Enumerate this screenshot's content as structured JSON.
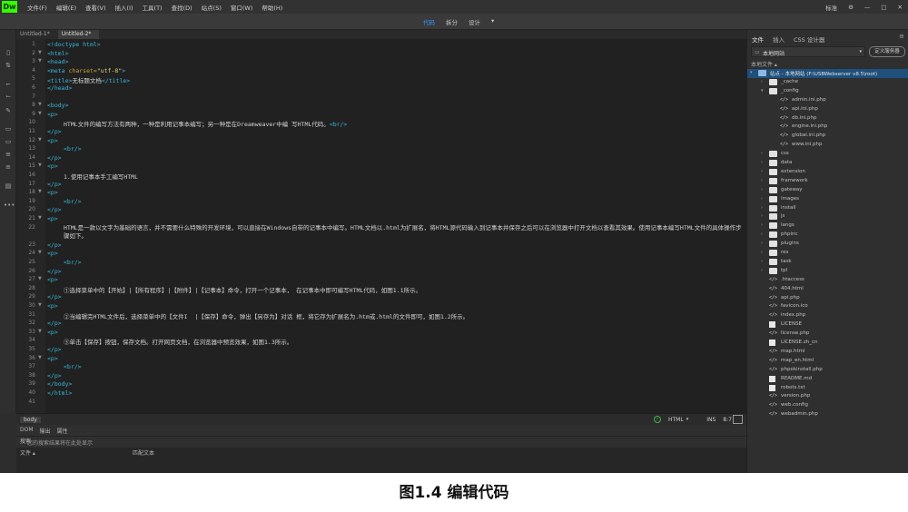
{
  "app": {
    "logo": "Dw",
    "menu": [
      "文件(F)",
      "编辑(E)",
      "查看(V)",
      "插入(I)",
      "工具(T)",
      "查找(D)",
      "站点(S)",
      "窗口(W)",
      "帮助(H)"
    ],
    "workspace": "标准",
    "window_controls": [
      "—",
      "□",
      "✕"
    ]
  },
  "view_bar": {
    "tabs": [
      "代码",
      "拆分",
      "设计"
    ],
    "active": "代码",
    "dropdown": "▾"
  },
  "doc_tabs": [
    "Untitled-1*",
    "Untitled-2*"
  ],
  "active_doc": "Untitled-2*",
  "code": [
    {
      "n": "1",
      "fold": "",
      "text": "<!doctype html>"
    },
    {
      "n": "2",
      "fold": "▼",
      "text": "<html>"
    },
    {
      "n": "3",
      "fold": "▼",
      "text": "<head>"
    },
    {
      "n": "4",
      "fold": "",
      "text": "<meta charset=\"utf-8\">"
    },
    {
      "n": "5",
      "fold": "",
      "text": "<title>无标题文档</title>"
    },
    {
      "n": "6",
      "fold": "",
      "text": "</head>"
    },
    {
      "n": "7",
      "fold": "",
      "text": ""
    },
    {
      "n": "8",
      "fold": "▼",
      "text": "<body>"
    },
    {
      "n": "9",
      "fold": "▼",
      "text": "<p>"
    },
    {
      "n": "10",
      "fold": "",
      "text": "HTML文件的编写方法有两种，一种是利用记事本编写；另一种是在Dreamweaver中编 写HTML代码。<br/>"
    },
    {
      "n": "11",
      "fold": "",
      "text": "</p>"
    },
    {
      "n": "12",
      "fold": "▼",
      "text": "<p>"
    },
    {
      "n": "13",
      "fold": "",
      "text": "<br/>"
    },
    {
      "n": "14",
      "fold": "",
      "text": "</p>"
    },
    {
      "n": "15",
      "fold": "▼",
      "text": "<p>"
    },
    {
      "n": "16",
      "fold": "",
      "text": "1.使用记事本手工编写HTML"
    },
    {
      "n": "17",
      "fold": "",
      "text": "</p>"
    },
    {
      "n": "18",
      "fold": "▼",
      "text": "<p>"
    },
    {
      "n": "19",
      "fold": "",
      "text": "<br/>"
    },
    {
      "n": "20",
      "fold": "",
      "text": "</p>"
    },
    {
      "n": "21",
      "fold": "▼",
      "text": "<p>"
    },
    {
      "n": "22",
      "fold": "",
      "text": "HTML是一款以文字为基础的语言，并不需要什么特殊的开发环境，可以直接在Windows自带的记事本中编写。HTML文档以.html为扩展名，将HTML源代码输入到记事本并保存之后可以在浏览器中打开文档以查看其效果。使用记事本编写HTML文件的具体操作步骤如下。"
    },
    {
      "n": "23",
      "fold": "",
      "text": "</p>"
    },
    {
      "n": "24",
      "fold": "▼",
      "text": "<p>"
    },
    {
      "n": "25",
      "fold": "",
      "text": "<br/>"
    },
    {
      "n": "26",
      "fold": "",
      "text": "</p>"
    },
    {
      "n": "27",
      "fold": "▼",
      "text": "<p>"
    },
    {
      "n": "28",
      "fold": "",
      "text": "①选择菜单中的【开始】|【所有程序】|【附件】|【记事本】命令，打开一个记事本， 在记事本中即可编写HTML代码，如图1.1所示。"
    },
    {
      "n": "29",
      "fold": "",
      "text": "</p>"
    },
    {
      "n": "30",
      "fold": "▼",
      "text": "<p>"
    },
    {
      "n": "31",
      "fold": "",
      "text": "②当编辑完HTML文件后，选择菜单中的【文件I  |【保存】命令，弹出【另存为】对话 框，将它存为扩展名为.htm或.html的文件即可，如图1.2所示。"
    },
    {
      "n": "32",
      "fold": "",
      "text": "</p>"
    },
    {
      "n": "33",
      "fold": "▼",
      "text": "<p>"
    },
    {
      "n": "34",
      "fold": "",
      "text": "③单击【保存】按钮，保存文档。打开网页文档，在浏览器中预览效果，如图1.3所示。"
    },
    {
      "n": "35",
      "fold": "",
      "text": "</p>"
    },
    {
      "n": "36",
      "fold": "▼",
      "text": "<p>"
    },
    {
      "n": "37",
      "fold": "",
      "text": "<br/>"
    },
    {
      "n": "38",
      "fold": "",
      "text": "</p>"
    },
    {
      "n": "39",
      "fold": "",
      "text": "</body>"
    },
    {
      "n": "40",
      "fold": "",
      "text": "</html>"
    },
    {
      "n": "41",
      "fold": "",
      "text": ""
    }
  ],
  "status_bar": {
    "tag": "body",
    "language": "HTML",
    "mode": "INS",
    "position": "8:7",
    "ok_icon": "✓"
  },
  "bottom_panel": {
    "tabs": [
      "DOM",
      "输出",
      "属性"
    ],
    "search_tab": "搜索",
    "search_placeholder": "您的搜索结果将在此处显示",
    "col_file": "文件 ▴",
    "col_match": "匹配文本"
  },
  "right_panel": {
    "tabs": [
      "文件",
      "插入",
      "CSS 设计器"
    ],
    "active_tab": "文件",
    "site_select": "本地网站",
    "define_button": "定义服务器",
    "local_label": "本地文件 ▴",
    "tree": [
      {
        "label": "站点 - 本地网站 (F:\\USBWebserver v8.5\\root)",
        "icon": "site",
        "depth": 0,
        "chev": "▾",
        "selected": true
      },
      {
        "label": "_cache",
        "icon": "folder",
        "depth": 1,
        "chev": "›"
      },
      {
        "label": "_config",
        "icon": "folder",
        "depth": 1,
        "chev": "▾"
      },
      {
        "label": "admin.ini.php",
        "icon": "code",
        "depth": 2,
        "chev": ""
      },
      {
        "label": "api.ini.php",
        "icon": "code",
        "depth": 2,
        "chev": ""
      },
      {
        "label": "db.ini.php",
        "icon": "code",
        "depth": 2,
        "chev": ""
      },
      {
        "label": "engine.ini.php",
        "icon": "code",
        "depth": 2,
        "chev": ""
      },
      {
        "label": "global.ini.php",
        "icon": "code",
        "depth": 2,
        "chev": ""
      },
      {
        "label": "www.ini.php",
        "icon": "code",
        "depth": 2,
        "chev": ""
      },
      {
        "label": "css",
        "icon": "folder",
        "depth": 1,
        "chev": "›"
      },
      {
        "label": "data",
        "icon": "folder",
        "depth": 1,
        "chev": "›"
      },
      {
        "label": "extension",
        "icon": "folder",
        "depth": 1,
        "chev": "›"
      },
      {
        "label": "framework",
        "icon": "folder",
        "depth": 1,
        "chev": "›"
      },
      {
        "label": "gateway",
        "icon": "folder",
        "depth": 1,
        "chev": "›"
      },
      {
        "label": "images",
        "icon": "folder",
        "depth": 1,
        "chev": "›"
      },
      {
        "label": "install",
        "icon": "folder",
        "depth": 1,
        "chev": "›"
      },
      {
        "label": "js",
        "icon": "folder",
        "depth": 1,
        "chev": "›"
      },
      {
        "label": "langs",
        "icon": "folder",
        "depth": 1,
        "chev": "›"
      },
      {
        "label": "phpinc",
        "icon": "folder",
        "depth": 1,
        "chev": "›"
      },
      {
        "label": "plugins",
        "icon": "folder",
        "depth": 1,
        "chev": "›"
      },
      {
        "label": "res",
        "icon": "folder",
        "depth": 1,
        "chev": "›"
      },
      {
        "label": "task",
        "icon": "folder",
        "depth": 1,
        "chev": "›"
      },
      {
        "label": "tpl",
        "icon": "folder",
        "depth": 1,
        "chev": "›"
      },
      {
        "label": ".htaccess",
        "icon": "code",
        "depth": 1,
        "chev": ""
      },
      {
        "label": "404.html",
        "icon": "code",
        "depth": 1,
        "chev": ""
      },
      {
        "label": "api.php",
        "icon": "code",
        "depth": 1,
        "chev": ""
      },
      {
        "label": "favicon.ico",
        "icon": "code",
        "depth": 1,
        "chev": ""
      },
      {
        "label": "index.php",
        "icon": "code",
        "depth": 1,
        "chev": ""
      },
      {
        "label": "LICENSE",
        "icon": "doc",
        "depth": 1,
        "chev": ""
      },
      {
        "label": "license.php",
        "icon": "code",
        "depth": 1,
        "chev": ""
      },
      {
        "label": "LICENSE.zh_cn",
        "icon": "doc",
        "depth": 1,
        "chev": ""
      },
      {
        "label": "map.html",
        "icon": "code",
        "depth": 1,
        "chev": ""
      },
      {
        "label": "map_en.html",
        "icon": "code",
        "depth": 1,
        "chev": ""
      },
      {
        "label": "phpokinstall.php",
        "icon": "code",
        "depth": 1,
        "chev": ""
      },
      {
        "label": "README.md",
        "icon": "doc",
        "depth": 1,
        "chev": ""
      },
      {
        "label": "robots.txt",
        "icon": "doc",
        "depth": 1,
        "chev": ""
      },
      {
        "label": "version.php",
        "icon": "code",
        "depth": 1,
        "chev": ""
      },
      {
        "label": "web.config",
        "icon": "code",
        "depth": 1,
        "chev": ""
      },
      {
        "label": "webadmin.php",
        "icon": "code",
        "depth": 1,
        "chev": ""
      }
    ]
  },
  "caption": "图1.4  编辑代码",
  "colors": {
    "accent": "#2f9bff",
    "tag": "#38b6d8",
    "logo": "#35fa00"
  }
}
